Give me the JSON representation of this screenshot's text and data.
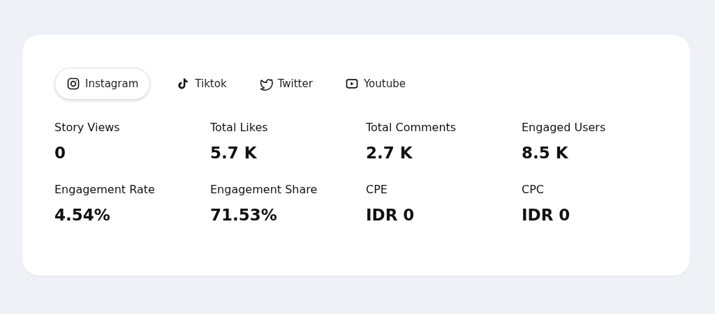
{
  "tabs": [
    {
      "kind": "instagram",
      "label": "Instagram",
      "selected": true
    },
    {
      "kind": "tiktok",
      "label": "Tiktok",
      "selected": false
    },
    {
      "kind": "twitter",
      "label": "Twitter",
      "selected": false
    },
    {
      "kind": "youtube",
      "label": "Youtube",
      "selected": false
    }
  ],
  "metrics": [
    {
      "label": "Story Views",
      "value": "0"
    },
    {
      "label": "Total Likes",
      "value": "5.7 K"
    },
    {
      "label": "Total Comments",
      "value": "2.7 K"
    },
    {
      "label": "Engaged Users",
      "value": "8.5 K"
    },
    {
      "label": "Engagement Rate",
      "value": "4.54%"
    },
    {
      "label": "Engagement Share",
      "value": "71.53%"
    },
    {
      "label": "CPE",
      "value": "IDR 0"
    },
    {
      "label": "CPC",
      "value": "IDR 0"
    }
  ]
}
